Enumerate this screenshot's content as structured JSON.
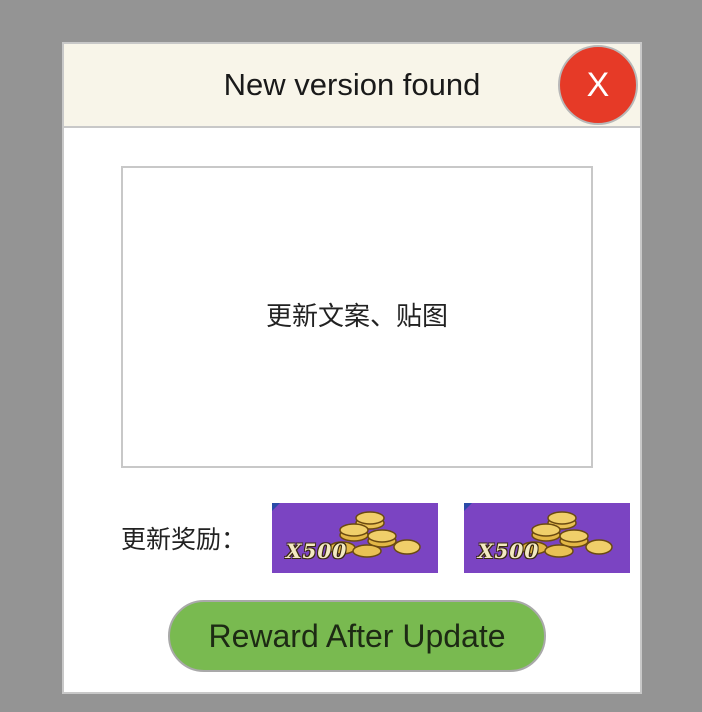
{
  "dialog": {
    "title": "New version found",
    "close_label": "X",
    "content_placeholder": "更新文案、贴图",
    "reward_label": "更新奖励：",
    "rewards": [
      {
        "icon": "gold-coins-icon",
        "quantity": "X500"
      },
      {
        "icon": "gold-coins-icon",
        "quantity": "X500"
      }
    ],
    "update_button_label": "Reward After Update"
  },
  "colors": {
    "overlay": "#949494",
    "header_bg": "#f8f5e9",
    "close_button": "#e63a27",
    "update_button": "#79ba50",
    "reward_bg": "#7b44c2"
  }
}
